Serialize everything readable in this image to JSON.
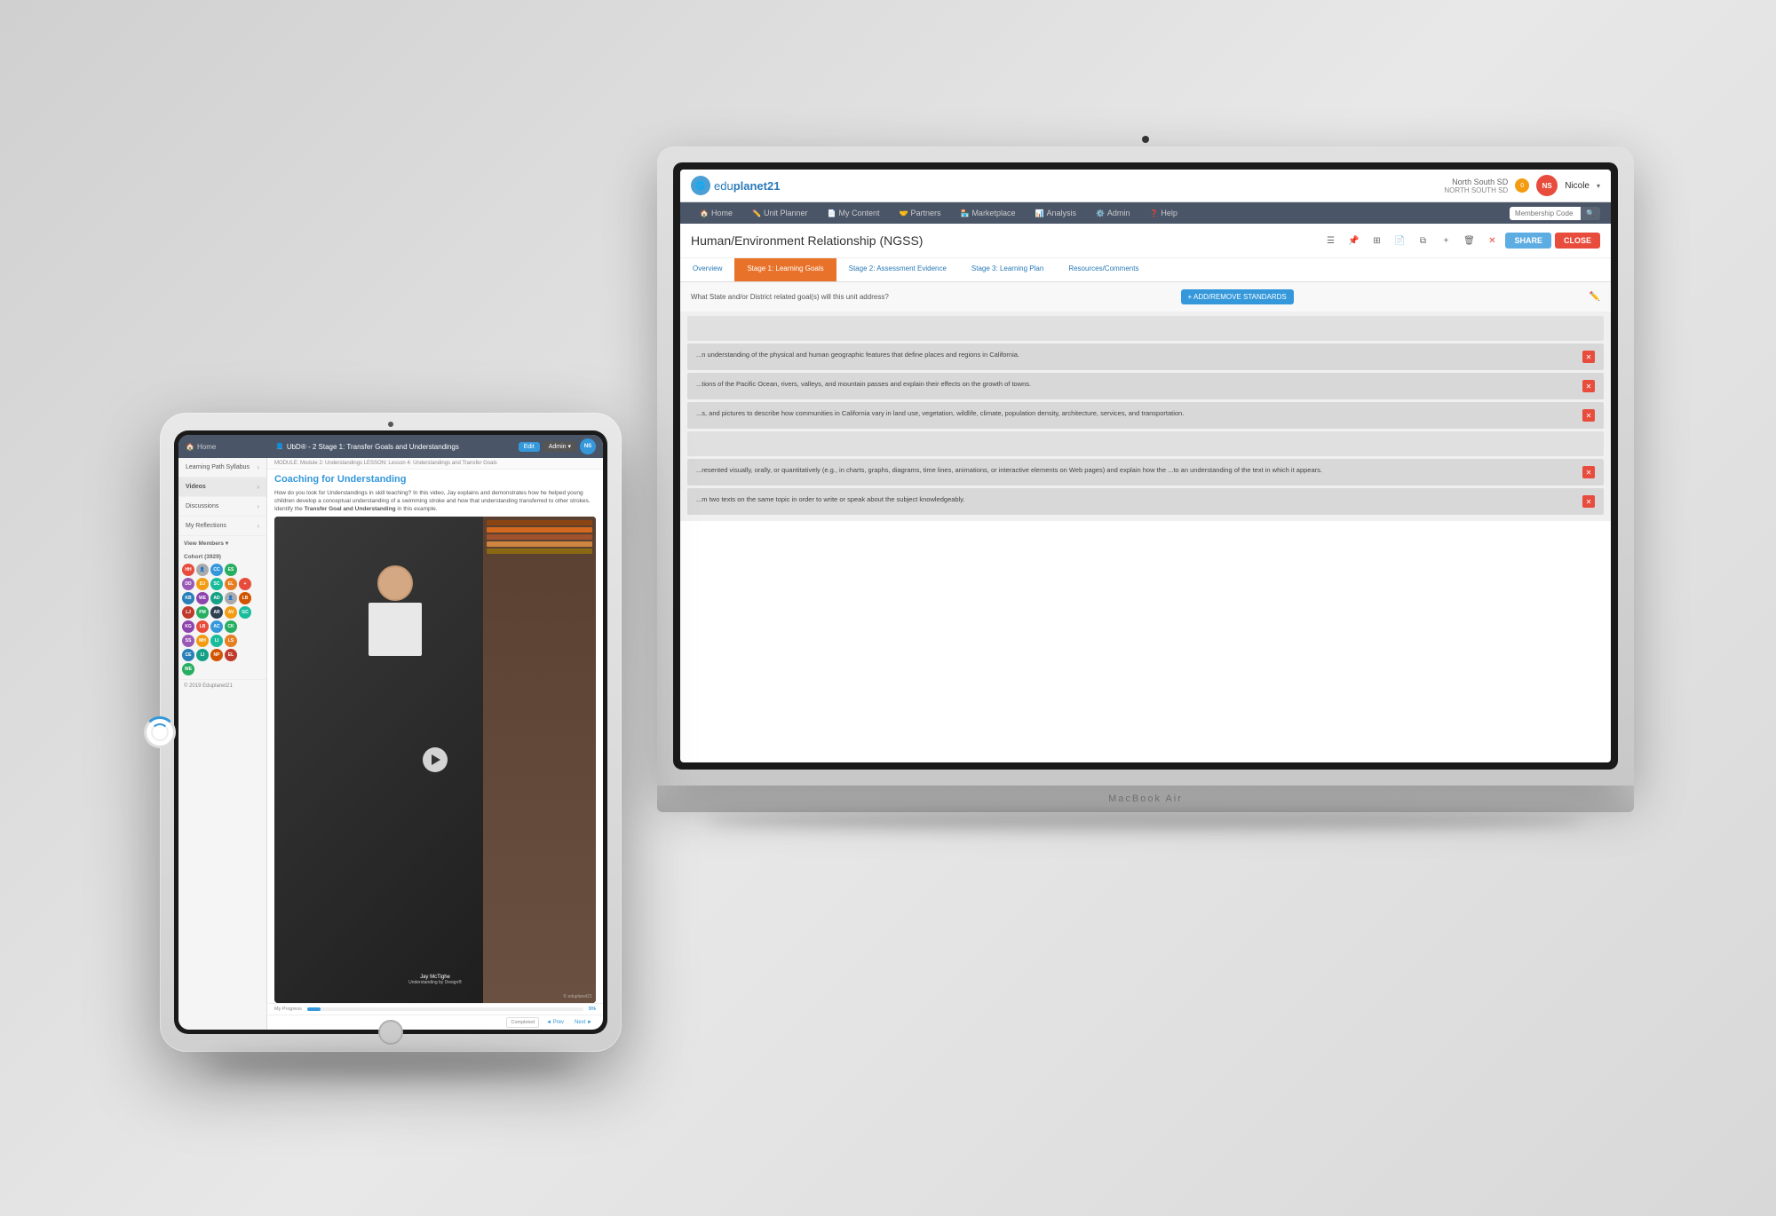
{
  "app": {
    "logo_text": "edu",
    "logo_text2": "planet21",
    "logo_icon": "🌐"
  },
  "laptop": {
    "brand": "MacBook Air",
    "topbar": {
      "logo": "eduplanet21",
      "district_label": "North South SD",
      "district_sub": "NORTH SOUTH SD",
      "avatar_initials": "NS",
      "user_name": "Nicole",
      "notification_count": "0"
    },
    "navbar": {
      "items": [
        {
          "label": "Home",
          "icon": "🏠"
        },
        {
          "label": "Unit Planner",
          "icon": "✏️"
        },
        {
          "label": "My Content",
          "icon": "📄"
        },
        {
          "label": "Partners",
          "icon": "🤝"
        },
        {
          "label": "Marketplace",
          "icon": "🏪"
        },
        {
          "label": "Analysis",
          "icon": "📊"
        },
        {
          "label": "Admin",
          "icon": "⚙️"
        },
        {
          "label": "Help",
          "icon": "❓"
        }
      ],
      "search_placeholder": "Membership Code"
    },
    "content_title": "Human/Environment Relationship (NGSS)",
    "buttons": {
      "share": "SHARE",
      "close": "CLOSE"
    },
    "tabs": [
      {
        "label": "Overview",
        "active": false
      },
      {
        "label": "Stage 1: Learning Goals",
        "active": true
      },
      {
        "label": "Stage 2: Assessment Evidence",
        "active": false
      },
      {
        "label": "Stage 3: Learning Plan",
        "active": false
      },
      {
        "label": "Resources/Comments",
        "active": false
      }
    ],
    "standards_question": "What State and/or District related goal(s) will this unit address?",
    "add_standards_btn": "+ ADD/REMOVE STANDARDS",
    "rows": [
      {
        "text": "...n understanding of the physical and human geographic features that define places and regions in California.",
        "has_delete": true
      },
      {
        "text": "...tions of the Pacific Ocean, rivers, valleys, and mountain passes and explain their effects on the growth of towns.",
        "has_delete": true
      },
      {
        "text": "...s, and pictures to describe how communities in California vary in land use, vegetation, wildlife, climate, population density, architecture, services, and transportation.",
        "has_delete": true
      },
      {
        "text": "...resented visually, orally, or quantitatively (e.g., in charts, graphs, diagrams, time lines, animations, or interactive elements on Web pages) and explain how the ...to an understanding of the text in which it appears.",
        "has_delete": true
      },
      {
        "text": "...m two texts on the same topic in order to write or speak about the subject knowledgeably.",
        "has_delete": true
      }
    ]
  },
  "ipad": {
    "navbar": {
      "home": "Home",
      "title": "UbD® - 2 Stage 1: Transfer Goals and Understandings",
      "edit_btn": "Edit",
      "admin_btn": "Admin ▾",
      "avatar_initials": "NS"
    },
    "breadcrumb": "MODULE: Module 2: Understandings   LESSON: Lesson 4: Understandings and Transfer Goals",
    "lesson_title": "Coaching for Understanding",
    "lesson_desc": "How do you look for Understandings in skill teaching? In this video, Jay explains and demonstrates how he helped young children develop a conceptual understanding of a swimming stroke and how that understanding transferred to other strokes. Identify the Transfer Goal and Understanding in this example.",
    "lesson_desc_bold": "Transfer Goal and Understanding",
    "sidebar_items": [
      {
        "label": "Learning Path Syllabus"
      },
      {
        "label": "Videos",
        "active": true
      },
      {
        "label": "Discussions"
      },
      {
        "label": "My Reflections"
      }
    ],
    "cohort_label": "View Members ▾",
    "cohort_label2": "Cohort (3929)",
    "footer": {
      "copyright": "© 2019 Eduplanet21",
      "progress_label": "My Progress",
      "progress_value": "5%",
      "completed_label": "Completed",
      "prev_btn": "◄ Prev",
      "next_btn": "Next ►"
    },
    "video": {
      "speaker_name": "Jay McTighe",
      "speaker_title": "Understanding by Design®",
      "logo": "© eduplanet21"
    },
    "cohort_avatars": [
      {
        "initials": "HH",
        "color": "#e74c3c"
      },
      {
        "initials": "CC",
        "color": "#3498db"
      },
      {
        "initials": "ES",
        "color": "#27ae60"
      },
      {
        "initials": "DD",
        "color": "#9b59b6"
      },
      {
        "initials": "DJ",
        "color": "#f39c12"
      },
      {
        "initials": "SC",
        "color": "#1abc9c"
      },
      {
        "initials": "EL",
        "color": "#e67e22"
      },
      {
        "initials": "KB",
        "color": "#2980b9"
      },
      {
        "initials": "WE",
        "color": "#8e44ad"
      },
      {
        "initials": "AD",
        "color": "#16a085"
      },
      {
        "initials": "LB",
        "color": "#d35400"
      },
      {
        "initials": "LJ",
        "color": "#c0392b"
      },
      {
        "initials": "PM",
        "color": "#27ae60"
      },
      {
        "initials": "AR",
        "color": "#2c3e50"
      },
      {
        "initials": "AV",
        "color": "#f39c12"
      },
      {
        "initials": "GC",
        "color": "#1abc9c"
      },
      {
        "initials": "KG",
        "color": "#8e44ad"
      },
      {
        "initials": "LB",
        "color": "#e74c3c"
      },
      {
        "initials": "AC",
        "color": "#3498db"
      },
      {
        "initials": "CK",
        "color": "#27ae60"
      },
      {
        "initials": "SS",
        "color": "#9b59b6"
      },
      {
        "initials": "MH",
        "color": "#f39c12"
      },
      {
        "initials": "LI",
        "color": "#1abc9c"
      },
      {
        "initials": "LS",
        "color": "#e67e22"
      },
      {
        "initials": "CE",
        "color": "#2980b9"
      },
      {
        "initials": "LI",
        "color": "#16a085"
      },
      {
        "initials": "NP",
        "color": "#d35400"
      },
      {
        "initials": "EL",
        "color": "#c0392b"
      },
      {
        "initials": "WE",
        "color": "#27ae60"
      }
    ]
  }
}
